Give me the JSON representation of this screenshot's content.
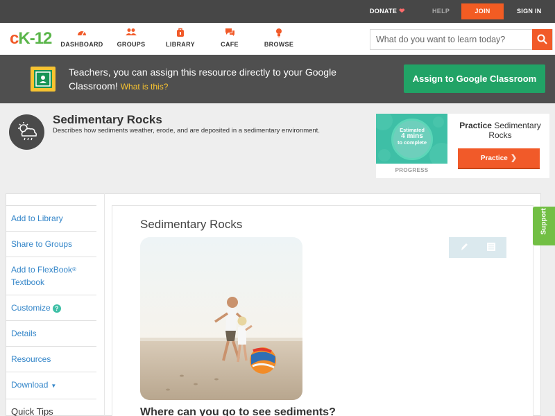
{
  "topbar": {
    "donate_label": "DONATE",
    "help_label": "HELP",
    "join_label": "JOIN",
    "signin_label": "SIGN IN"
  },
  "navbar": {
    "logo_text": "cK-12",
    "items": [
      {
        "label": "DASHBOARD",
        "icon": "dashboard-icon"
      },
      {
        "label": "GROUPS",
        "icon": "groups-icon"
      },
      {
        "label": "LIBRARY",
        "icon": "library-icon"
      },
      {
        "label": "CAFE",
        "icon": "cafe-icon"
      },
      {
        "label": "BROWSE",
        "icon": "browse-icon"
      }
    ],
    "search_placeholder": "What do you want to learn today?"
  },
  "banner": {
    "text": "Teachers, you can assign this resource directly to your Google Classroom!",
    "what_link": "What is this?",
    "assign_label": "Assign to Google Classroom"
  },
  "concept": {
    "title": "Sedimentary Rocks",
    "description": "Describes how sediments weather, erode, and are deposited in a sedimentary environment."
  },
  "practice": {
    "estimate_line1": "Estimated",
    "estimate_line2": "4 mins",
    "estimate_line3": "to complete",
    "progress_label": "PROGRESS",
    "title_bold": "Practice",
    "title_rest": "Sedimentary Rocks",
    "button_label": "Practice"
  },
  "sidebar": {
    "items": [
      {
        "label": "Add to Library"
      },
      {
        "label": "Share to Groups"
      },
      {
        "label": "Add to FlexBook",
        "sup": "®",
        "line2": "Textbook"
      },
      {
        "label": "Customize"
      },
      {
        "label": "Details"
      },
      {
        "label": "Resources"
      },
      {
        "label": "Download"
      },
      {
        "label": "Quick Tips"
      }
    ]
  },
  "article": {
    "title": "Sedimentary Rocks",
    "section_heading": "Where can you go to see sediments?"
  },
  "support_label": "Support",
  "colors": {
    "brand_orange": "#f15a29",
    "brand_green": "#5ab54a",
    "classroom_green": "#21a366",
    "link_blue": "#3486c9"
  }
}
